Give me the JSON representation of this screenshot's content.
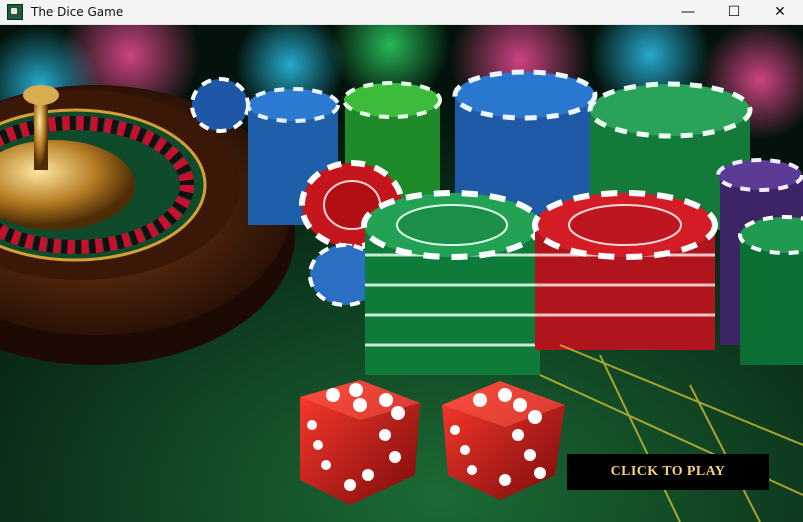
{
  "window": {
    "title": "The Dice Game",
    "controls": {
      "minimize": "—",
      "maximize": "☐",
      "close": "✕"
    }
  },
  "game": {
    "play_button_label": "CLICK TO PLAY",
    "accent_color": "#f4d27a"
  }
}
